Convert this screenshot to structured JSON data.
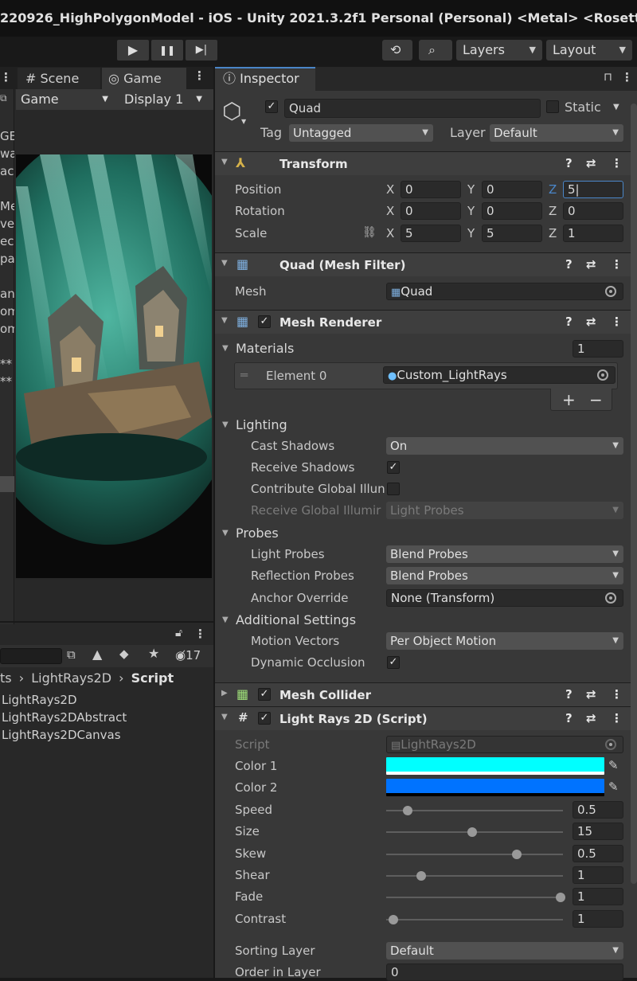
{
  "window_title": "220926_HighPolygonModel - iOS - Unity 2021.3.2f1 Personal (Personal) <Metal> <Rosetta>",
  "toolbar": {
    "play_glyph": "▶",
    "pause_glyph": "❚❚",
    "step_glyph": "▶|",
    "layers_label": "Layers",
    "layout_label": "Layout"
  },
  "left": {
    "tab_scene": "Scene",
    "tab_game": "Game",
    "game_dropdown": "Game",
    "display_dropdown": "Display 1",
    "hierarchy_fragments": [
      "GE",
      "wa",
      "ac",
      "",
      "Me",
      "ve",
      "ech",
      "pa",
      "",
      "an",
      "om",
      "om",
      "",
      "**",
      "**"
    ],
    "project": {
      "hidden_count": "17",
      "breadcrumb": [
        "ts",
        "LightRays2D",
        "Script"
      ],
      "files": [
        "LightRays2D",
        "LightRays2DAbstract",
        "LightRays2DCanvas"
      ]
    }
  },
  "inspector": {
    "tab_label": "Inspector",
    "object_name": "Quad",
    "static_label": "Static",
    "tag_label": "Tag",
    "tag_value": "Untagged",
    "layer_label": "Layer",
    "layer_value": "Default",
    "transform": {
      "title": "Transform",
      "position_label": "Position",
      "rotation_label": "Rotation",
      "scale_label": "Scale",
      "position": {
        "x": "0",
        "y": "0",
        "z": "5"
      },
      "rotation": {
        "x": "0",
        "y": "0",
        "z": "0"
      },
      "scale": {
        "x": "5",
        "y": "5",
        "z": "1"
      }
    },
    "mesh_filter": {
      "title": "Quad (Mesh Filter)",
      "mesh_label": "Mesh",
      "mesh_value": "Quad"
    },
    "mesh_renderer": {
      "title": "Mesh Renderer",
      "materials_label": "Materials",
      "materials_count": "1",
      "element0_label": "Element 0",
      "element0_value": "Custom_LightRays",
      "plus": "+",
      "minus": "−",
      "lighting_label": "Lighting",
      "cast_shadows_label": "Cast Shadows",
      "cast_shadows_value": "On",
      "receive_shadows_label": "Receive Shadows",
      "contribute_gi_label": "Contribute Global Illun",
      "receive_gi_label": "Receive Global Illumir",
      "receive_gi_value": "Light Probes",
      "probes_label": "Probes",
      "light_probes_label": "Light Probes",
      "light_probes_value": "Blend Probes",
      "reflection_probes_label": "Reflection Probes",
      "reflection_probes_value": "Blend Probes",
      "anchor_override_label": "Anchor Override",
      "anchor_override_value": "None (Transform)",
      "additional_label": "Additional Settings",
      "motion_vectors_label": "Motion Vectors",
      "motion_vectors_value": "Per Object Motion",
      "dynamic_occlusion_label": "Dynamic Occlusion"
    },
    "mesh_collider": {
      "title": "Mesh Collider"
    },
    "light_rays": {
      "title": "Light Rays 2D (Script)",
      "script_label": "Script",
      "script_value": "LightRays2D",
      "color1_label": "Color 1",
      "color1": "#00ffff",
      "color2_label": "Color 2",
      "color2": "#0073ff",
      "sliders": [
        {
          "label": "Speed",
          "value": "0.5",
          "fraction": 0.12
        },
        {
          "label": "Size",
          "value": "15",
          "fraction": 0.485
        },
        {
          "label": "Skew",
          "value": "0.5",
          "fraction": 0.74
        },
        {
          "label": "Shear",
          "value": "1",
          "fraction": 0.2
        },
        {
          "label": "Fade",
          "value": "1",
          "fraction": 0.985
        },
        {
          "label": "Contrast",
          "value": "1",
          "fraction": 0.04
        }
      ],
      "sorting_layer_label": "Sorting Layer",
      "sorting_layer_value": "Default",
      "order_label": "Order in Layer",
      "order_value": "0"
    }
  },
  "colors": {
    "accent": "#4a86c8",
    "panel": "#383838"
  }
}
